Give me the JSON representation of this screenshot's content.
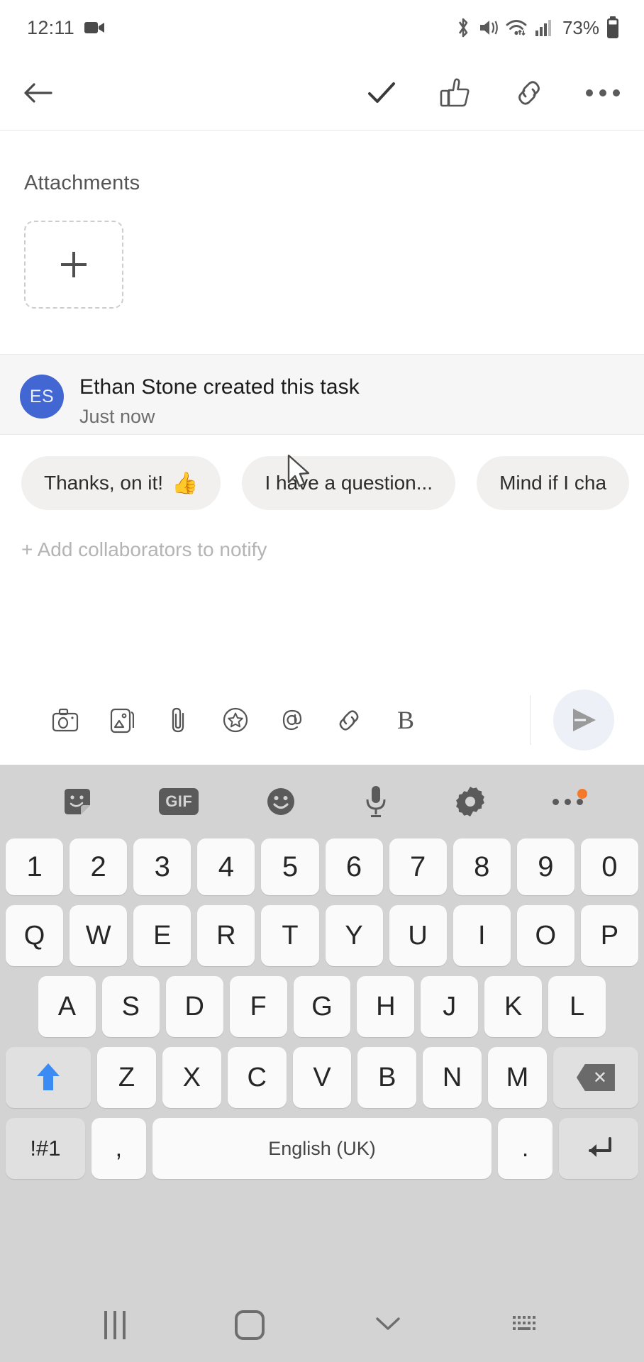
{
  "status_bar": {
    "time": "12:11",
    "battery_percent": "73%",
    "icons": [
      "video-recording-icon",
      "bluetooth-icon",
      "mute-vibrate-icon",
      "wifi-icon",
      "cellular-signal-icon",
      "battery-icon"
    ]
  },
  "app_bar": {
    "back_label": "back-arrow",
    "actions": [
      "complete-check",
      "thumbs-up",
      "link",
      "more-options"
    ]
  },
  "attachments": {
    "title": "Attachments",
    "add_label": "+"
  },
  "activity": {
    "avatar_initials": "ES",
    "avatar_color": "#4267d2",
    "text": "Ethan Stone created this task",
    "timestamp": "Just now"
  },
  "quick_replies": [
    {
      "text": "Thanks, on it!",
      "emoji": "👍"
    },
    {
      "text": "I have a question...",
      "emoji": ""
    },
    {
      "text": "Mind if I cha",
      "emoji": ""
    }
  ],
  "collaborators": {
    "label": "+ Add collaborators to notify"
  },
  "composer": {
    "tools": [
      "camera-icon",
      "gallery-icon",
      "paperclip-icon",
      "star-icon",
      "mention-icon",
      "link-icon",
      "bold-icon"
    ],
    "bold_label": "B",
    "send_label": "send-icon",
    "send_bg": "#eef0f8"
  },
  "keyboard": {
    "toolbar": [
      "sticker-icon",
      "gif-icon",
      "emoji-icon",
      "microphone-icon",
      "settings-gear-icon",
      "more-icon"
    ],
    "gif_label": "GIF",
    "rows": {
      "numbers": [
        "1",
        "2",
        "3",
        "4",
        "5",
        "6",
        "7",
        "8",
        "9",
        "0"
      ],
      "top": [
        "Q",
        "W",
        "E",
        "R",
        "T",
        "Y",
        "U",
        "I",
        "O",
        "P"
      ],
      "home": [
        "A",
        "S",
        "D",
        "F",
        "G",
        "H",
        "J",
        "K",
        "L"
      ],
      "bottom": [
        "Z",
        "X",
        "C",
        "V",
        "B",
        "N",
        "M"
      ]
    },
    "shift_label": "shift-icon",
    "backspace_label": "×",
    "symbols_label": "!#1",
    "comma_label": ",",
    "space_label": "English (UK)",
    "period_label": ".",
    "enter_label": "enter-icon",
    "shift_color": "#3b8bf4",
    "bg_color": "#d3d3d3"
  },
  "nav_bar": {
    "items": [
      "recents-icon",
      "home-icon",
      "hide-keyboard-icon",
      "keyboard-switch-icon"
    ]
  }
}
